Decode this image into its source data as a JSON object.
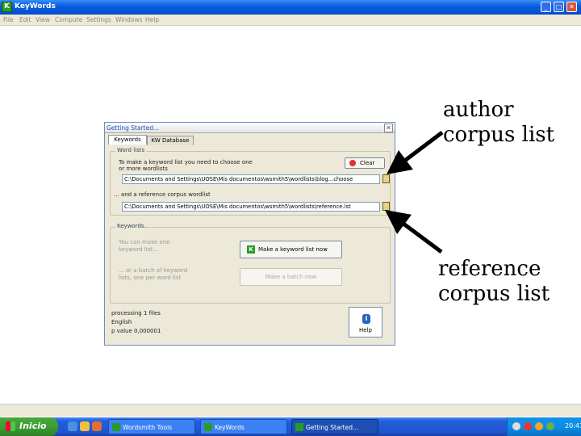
{
  "window": {
    "title": "KeyWords",
    "app_icon": "K",
    "minimize": "_",
    "maximize": "□",
    "close": "✕"
  },
  "menu": [
    "File",
    "Edit",
    "View",
    "Compute",
    "Settings",
    "Windows",
    "Help"
  ],
  "dialog": {
    "title": "Getting Started...",
    "close": "✕",
    "tabs": [
      "Keywords",
      "KW Database"
    ],
    "wordlists_group": "Word lists",
    "author_instruction_1": "To make a keyword list you need to choose one",
    "author_instruction_2": "or more wordlists",
    "clear_button": "Clear",
    "author_path": "C:\\Documents and Settings\\UOSE\\Mis documentos\\wsmith5\\wordlists\\blog...choose",
    "reference_instruction": "... and a reference corpus wordlist",
    "reference_path": "C:\\Documents and Settings\\UOSE\\Mis documentos\\wsmith5\\wordlists\\reference.lst",
    "keywords_group": "Keywords...",
    "make_list_text_1": "You can make one",
    "make_list_text_2": "keyword list...",
    "make_list_button": "Make a keyword list now",
    "batch_text_1": "... or a batch of keyword",
    "batch_text_2": "lists, one per word list",
    "batch_button": "Make a batch now",
    "status_1": "processing 1 files",
    "status_2": "English",
    "status_3": "p value   0,000001",
    "help_button": "Help",
    "help_icon": "i"
  },
  "annotations": {
    "author": [
      "author",
      "corpus list"
    ],
    "reference": [
      "reference",
      "corpus list"
    ]
  },
  "taskbar": {
    "start": "Inicio",
    "tasks": [
      "Wordsmith Tools",
      "KeyWords",
      "Getting Started..."
    ],
    "clock": "20:41"
  }
}
